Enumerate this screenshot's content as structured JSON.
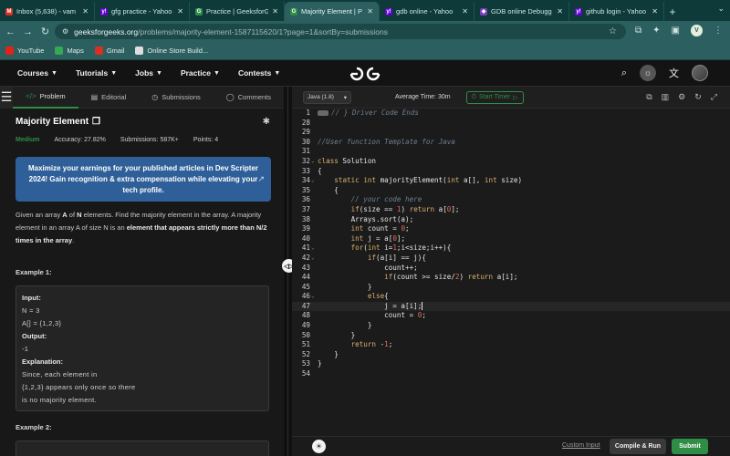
{
  "browser": {
    "tabs": [
      {
        "title": "Inbox (5,638) - vam",
        "icon": "gmail-icon",
        "color": "#d93025",
        "glyph": "M",
        "active": false
      },
      {
        "title": "gfg practice - Yahoo",
        "icon": "yahoo-icon",
        "color": "#6001d2",
        "glyph": "y!",
        "active": false
      },
      {
        "title": "Practice | GeeksforG",
        "icon": "gfg-icon",
        "color": "#2f8d46",
        "glyph": "G",
        "active": false
      },
      {
        "title": "Majority Element | P",
        "icon": "gfg-icon",
        "color": "#2f8d46",
        "glyph": "G",
        "active": true
      },
      {
        "title": "gdb online - Yahoo",
        "icon": "yahoo-icon",
        "color": "#6001d2",
        "glyph": "y!",
        "active": false
      },
      {
        "title": "GDB online Debugg",
        "icon": "gdb-icon",
        "color": "#7b3fbf",
        "glyph": "◆",
        "active": false
      },
      {
        "title": "github login - Yahoo",
        "icon": "yahoo-icon",
        "color": "#6001d2",
        "glyph": "y!",
        "active": false
      }
    ],
    "url_domain": "geeksforgeeks.org",
    "url_path": "/problems/majority-element-1587115620/1?page=1&sortBy=submissions",
    "profile_initial": "V",
    "bookmarks": [
      {
        "label": "YouTube",
        "color": "#e62117"
      },
      {
        "label": "Maps",
        "color": "#34a853"
      },
      {
        "label": "Gmail",
        "color": "#d93025"
      },
      {
        "label": "Online Store Build...",
        "color": "#dddddd"
      }
    ]
  },
  "nav": {
    "items": [
      "Courses",
      "Tutorials",
      "Jobs",
      "Practice",
      "Contests"
    ]
  },
  "left": {
    "tabs": [
      {
        "label": "Problem",
        "icon": "code-icon",
        "glyph": "</>"
      },
      {
        "label": "Editorial",
        "icon": "document-icon",
        "glyph": "▤"
      },
      {
        "label": "Submissions",
        "icon": "clock-icon",
        "glyph": "◷"
      },
      {
        "label": "Comments",
        "icon": "comment-icon",
        "glyph": "◯"
      }
    ],
    "title": "Majority Element",
    "difficulty": "Medium",
    "accuracy": "Accuracy: 27.82%",
    "submissions": "Submissions: 587K+",
    "points": "Points: 4",
    "promo": "Maximize your earnings for your published articles in Dev Scripter 2024! Gain recognition & extra compensation while elevating your tech profile.",
    "desc_1": "Given an array ",
    "desc_A": "A",
    "desc_2": " of ",
    "desc_N": "N",
    "desc_3": " elements. Find the majority element in the array. A majority element in an array A of size N is an ",
    "desc_bold": "element that appears strictly more than N/2 times in the array",
    "desc_4": ".",
    "example1_heading": "Example 1:",
    "example1": {
      "input_label": "Input:",
      "n_line": "N = 3",
      "arr_line": "A[] = {1,2,3}",
      "output_label": "Output:",
      "output": "-1",
      "explanation_label": "Explanation:",
      "explanation_1": "Since, each element in",
      "explanation_2": "{1,2,3} appears only once so there",
      "explanation_3": "is no majority element."
    },
    "example2_heading": "Example 2:"
  },
  "editor": {
    "language": "Java (1.8)",
    "avg_time": "Average Time: 30m",
    "timer_label": "Start Timer",
    "custom_input": "Custom Input",
    "compile_label": "Compile & Run",
    "submit_label": "Submit",
    "lines": [
      {
        "n": "1",
        "t": "// } Driver Code Ends"
      },
      {
        "n": "28",
        "t": ""
      },
      {
        "n": "29",
        "t": ""
      },
      {
        "n": "30",
        "t": "//User function Template for Java"
      },
      {
        "n": "31",
        "t": ""
      },
      {
        "n": "32",
        "t": "class Solution"
      },
      {
        "n": "33",
        "t": "{"
      },
      {
        "n": "34",
        "t": "    static int majorityElement(int a[], int size)"
      },
      {
        "n": "35",
        "t": "    {"
      },
      {
        "n": "36",
        "t": "        // your code here"
      },
      {
        "n": "37",
        "t": "        if(size == 1) return a[0];"
      },
      {
        "n": "38",
        "t": "        Arrays.sort(a);"
      },
      {
        "n": "39",
        "t": "        int count = 0;"
      },
      {
        "n": "40",
        "t": "        int j = a[0];"
      },
      {
        "n": "41",
        "t": "        for(int i=1;i<size;i++){"
      },
      {
        "n": "42",
        "t": "            if(a[i] == j){"
      },
      {
        "n": "43",
        "t": "                count++;"
      },
      {
        "n": "44",
        "t": "                if(count >= size/2) return a[i];"
      },
      {
        "n": "45",
        "t": "            }"
      },
      {
        "n": "46",
        "t": "            else{"
      },
      {
        "n": "47",
        "t": "                j = a[i];"
      },
      {
        "n": "48",
        "t": "                count = 0;"
      },
      {
        "n": "49",
        "t": "            }"
      },
      {
        "n": "50",
        "t": "        }"
      },
      {
        "n": "51",
        "t": "        return -1;"
      },
      {
        "n": "52",
        "t": "    }"
      },
      {
        "n": "53",
        "t": "}"
      },
      {
        "n": "54",
        "t": ""
      }
    ]
  },
  "colors": {
    "accent": "#2f8d46",
    "promo": "#2e5f98",
    "browser_chrome": "#2c5f5f"
  }
}
